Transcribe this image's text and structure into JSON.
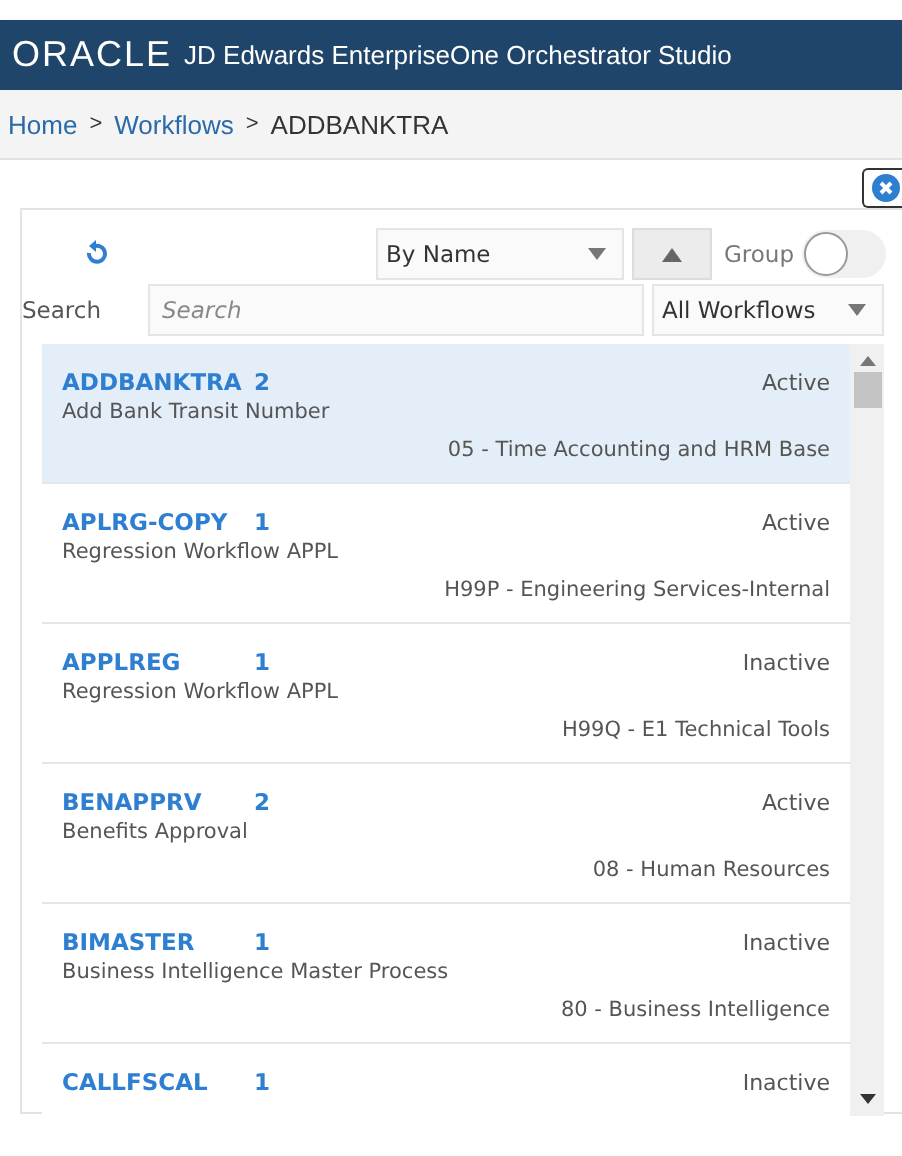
{
  "header": {
    "logo": "ORACLE",
    "title": "JD Edwards EnterpriseOne Orchestrator Studio"
  },
  "breadcrumb": [
    {
      "label": "Home",
      "link": true
    },
    {
      "separator": ">",
      "label": "Workflows",
      "link": true
    },
    {
      "separator": ">",
      "label": "ADDBANKTRA",
      "link": false
    }
  ],
  "toolbar": {
    "sort": "By Name",
    "group_label": "Group",
    "group_on": false
  },
  "search": {
    "label": "Search",
    "placeholder": "Search",
    "filter": "All Workflows"
  },
  "workflows": [
    {
      "name": "ADDBANKTRA",
      "version": "2",
      "description": "Add Bank Transit Number",
      "status": "Active",
      "product": "05 - Time Accounting and HRM Base",
      "selected": true
    },
    {
      "name": "APLRG-COPY",
      "version": "1",
      "description": "Regression Workflow APPL",
      "status": "Active",
      "product": "H99P - Engineering Services-Internal",
      "selected": false
    },
    {
      "name": "APPLREG",
      "version": "1",
      "description": "Regression Workflow APPL",
      "status": "Inactive",
      "product": "H99Q - E1 Technical Tools",
      "selected": false
    },
    {
      "name": "BENAPPRV",
      "version": "2",
      "description": "Benefits Approval",
      "status": "Active",
      "product": "08 - Human Resources",
      "selected": false
    },
    {
      "name": "BIMASTER",
      "version": "1",
      "description": "Business Intelligence Master Process",
      "status": "Inactive",
      "product": "80 - Business Intelligence",
      "selected": false
    },
    {
      "name": "CALLFSCAL",
      "version": "1",
      "status": "Inactive",
      "selected": false
    }
  ]
}
